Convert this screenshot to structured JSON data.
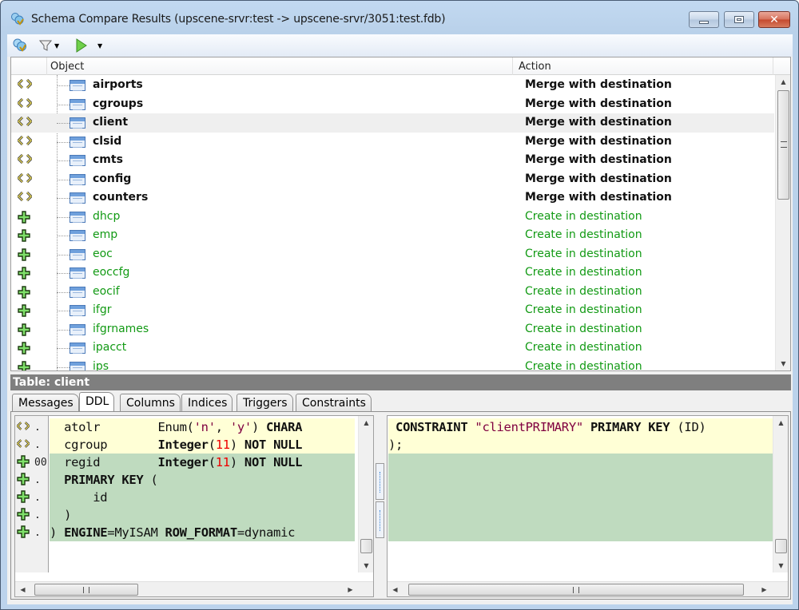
{
  "window": {
    "title": "Schema Compare Results (upscene-srvr:test -> upscene-srvr/3051:test.fdb)",
    "icon": "schema-compare-icon",
    "controls": {
      "minimize": "minimize-icon",
      "maximize": "maximize-icon",
      "close": "close-icon"
    }
  },
  "toolbar": {
    "items": [
      {
        "name": "compare-icon"
      },
      {
        "name": "filter-icon",
        "dropdown": true
      },
      {
        "name": "run-icon",
        "dropdown": true
      }
    ]
  },
  "grid": {
    "columns": [
      "Object",
      "Action"
    ],
    "selected_index": 2,
    "rows": [
      {
        "state": "merge",
        "name": "airports",
        "action": "Merge with destination"
      },
      {
        "state": "merge",
        "name": "cgroups",
        "action": "Merge with destination"
      },
      {
        "state": "merge",
        "name": "client",
        "action": "Merge with destination"
      },
      {
        "state": "merge",
        "name": "clsid",
        "action": "Merge with destination"
      },
      {
        "state": "merge",
        "name": "cmts",
        "action": "Merge with destination"
      },
      {
        "state": "merge",
        "name": "config",
        "action": "Merge with destination"
      },
      {
        "state": "merge",
        "name": "counters",
        "action": "Merge with destination"
      },
      {
        "state": "create",
        "name": "dhcp",
        "action": "Create in destination"
      },
      {
        "state": "create",
        "name": "emp",
        "action": "Create in destination"
      },
      {
        "state": "create",
        "name": "eoc",
        "action": "Create in destination"
      },
      {
        "state": "create",
        "name": "eoccfg",
        "action": "Create in destination"
      },
      {
        "state": "create",
        "name": "eocif",
        "action": "Create in destination"
      },
      {
        "state": "create",
        "name": "ifgr",
        "action": "Create in destination"
      },
      {
        "state": "create",
        "name": "ifgrnames",
        "action": "Create in destination"
      },
      {
        "state": "create",
        "name": "ipacct",
        "action": "Create in destination"
      },
      {
        "state": "create",
        "name": "ips",
        "action": "Create in destination"
      }
    ]
  },
  "detail": {
    "header": "Table: client",
    "tabs": [
      "Messages",
      "DDL",
      "Columns",
      "Indices",
      "Triggers",
      "Constraints"
    ],
    "active_tab": "DDL",
    "left_gutter": [
      {
        "icon": "merge",
        "mark": "."
      },
      {
        "icon": "merge",
        "mark": "."
      },
      {
        "icon": "add",
        "mark": "00"
      },
      {
        "icon": "add",
        "mark": "."
      },
      {
        "icon": "add",
        "mark": "."
      },
      {
        "icon": "add",
        "mark": "."
      },
      {
        "icon": "add",
        "mark": "."
      }
    ],
    "left_lines": [
      {
        "bg": "yel",
        "text": "  atolr        Enum('n', 'y') CHARA"
      },
      {
        "bg": "yel",
        "text": "  cgroup       Integer(11) NOT NULL"
      },
      {
        "bg": "grn",
        "text": "  regid        Integer(11) NOT NULL"
      },
      {
        "bg": "grn",
        "text": "  PRIMARY KEY ("
      },
      {
        "bg": "grn",
        "text": "      id"
      },
      {
        "bg": "grn",
        "text": "  )"
      },
      {
        "bg": "grn",
        "text": ") ENGINE=MyISAM ROW_FORMAT=dynamic"
      }
    ],
    "right_lines": [
      {
        "bg": "yel",
        "text": " CONSTRAINT \"clientPRIMARY\" PRIMARY KEY (ID)"
      },
      {
        "bg": "yel",
        "text": ");"
      },
      {
        "bg": "grn",
        "text": ""
      },
      {
        "bg": "grn",
        "text": ""
      },
      {
        "bg": "grn",
        "text": ""
      },
      {
        "bg": "grn",
        "text": ""
      },
      {
        "bg": "grn",
        "text": ""
      }
    ]
  },
  "colors": {
    "merge_text": "#111111",
    "create_text": "#129a14",
    "changed_line": "#ffffd6",
    "added_line": "#bfdbbf",
    "detail_header_bg": "#7f7f7f"
  }
}
